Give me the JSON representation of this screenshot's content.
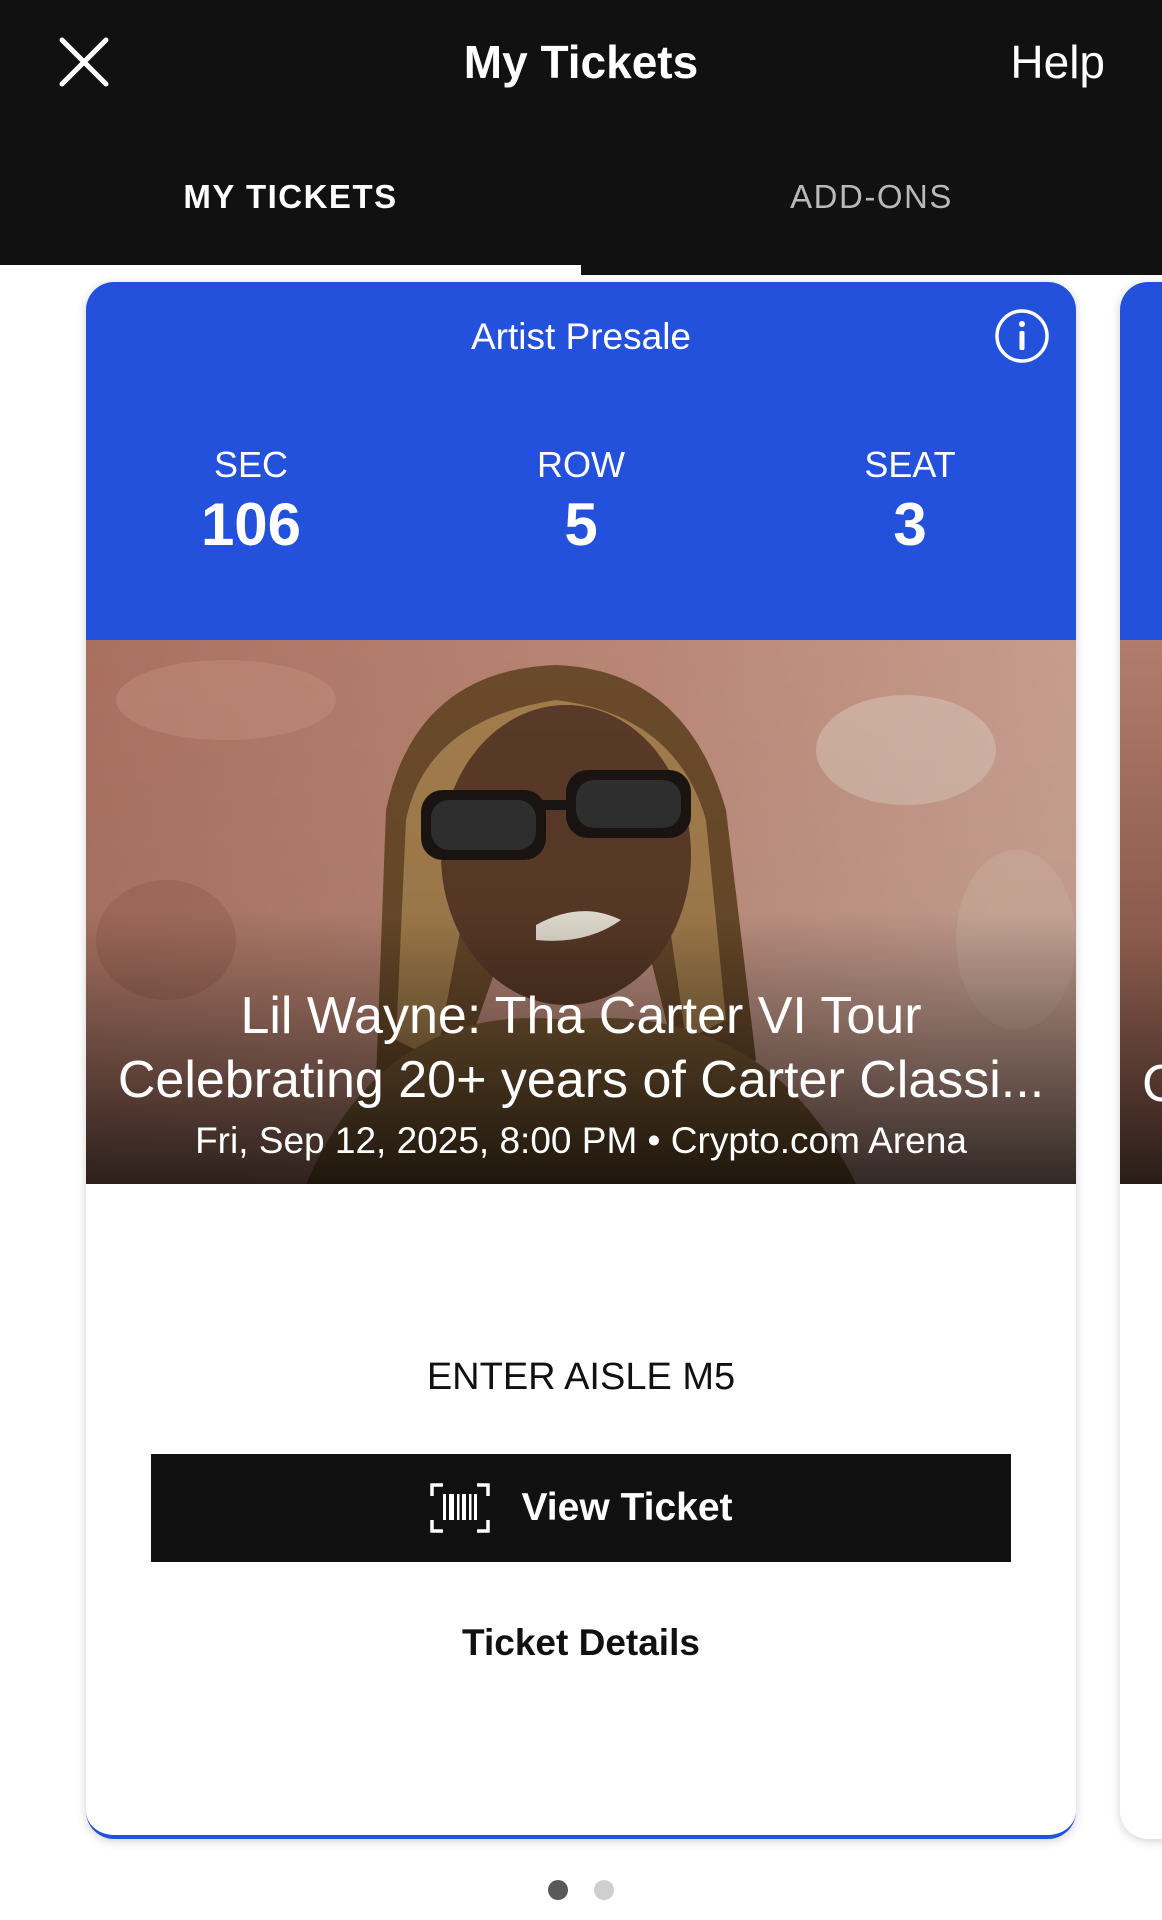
{
  "header": {
    "title": "My Tickets",
    "help_label": "Help",
    "close_icon": "close-icon"
  },
  "tabs": [
    {
      "label": "MY TICKETS",
      "active": true
    },
    {
      "label": "ADD-ONS",
      "active": false
    }
  ],
  "ticket": {
    "presale_label": "Artist Presale",
    "info_icon": "info-icon",
    "section_label": "SEC",
    "section_value": "106",
    "row_label": "ROW",
    "row_value": "5",
    "seat_label": "SEAT",
    "seat_value": "3",
    "event_title_line1": "Lil Wayne: Tha Carter VI Tour",
    "event_title_line2": "Celebrating 20+ years of Carter Classi...",
    "event_meta": "Fri, Sep 12, 2025, 8:00 PM • Crypto.com Arena",
    "entry_text": "ENTER AISLE M5",
    "view_ticket_label": "View Ticket",
    "barcode_icon": "barcode-icon",
    "details_label": "Ticket Details"
  },
  "next_card_peek": {
    "title_initial": "C"
  },
  "pager": {
    "total": 2,
    "active_index": 0
  },
  "colors": {
    "header_bg": "#111111",
    "accent_blue": "#2451dc",
    "button_bg": "#111111",
    "dot_active": "#595959",
    "dot_inactive": "#cfcfcf"
  }
}
